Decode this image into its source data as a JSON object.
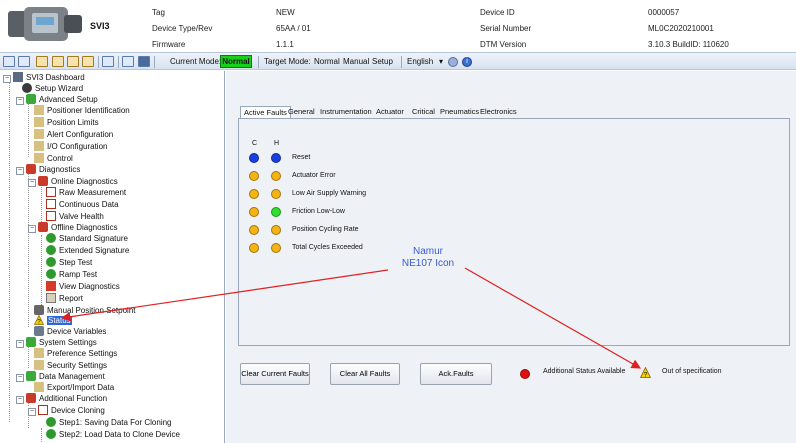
{
  "header": {
    "model": "SVI3",
    "tag_label": "Tag",
    "tag_value": "NEW",
    "device_type_label": "Device Type/Rev",
    "device_type_value": "65AA / 01",
    "firmware_label": "Firmware",
    "firmware_value": "1.1.1",
    "device_id_label": "Device ID",
    "device_id_value": "0000057",
    "serial_label": "Serial Number",
    "serial_value": "ML0C2020210001",
    "dtm_label": "DTM Version",
    "dtm_value": "3.10.3 BuildID: 110620"
  },
  "toolbar": {
    "current_mode_label": "Current Mode:",
    "current_mode_value": "Normal",
    "target_mode_label": "Target Mode:",
    "mode_normal": "Normal",
    "mode_manual": "Manual",
    "mode_setup": "Setup",
    "language": "English"
  },
  "tree": {
    "root": "SVI3 Dashboard",
    "setup_wizard": "Setup Wizard",
    "advanced_setup": "Advanced Setup",
    "positioner_identification": "Positioner Identification",
    "position_limits": "Position Limits",
    "alert_configuration": "Alert Configuration",
    "io_configuration": "I/O Configuration",
    "control": "Control",
    "diagnostics": "Diagnostics",
    "online_diagnostics": "Online Diagnostics",
    "raw_measurement": "Raw Measurement",
    "continuous_data": "Continuous Data",
    "valve_health": "Valve Health",
    "offline_diagnostics": "Offline Diagnostics",
    "standard_signature": "Standard Signature",
    "extended_signature": "Extended Signature",
    "step_test": "Step Test",
    "ramp_test": "Ramp Test",
    "view_diagnostics": "View Diagnostics",
    "report": "Report",
    "manual_position_setpoint": "Manual Position Setpoint",
    "status": "Status",
    "device_variables": "Device Variables",
    "system_settings": "System Settings",
    "preference_settings": "Preference Settings",
    "security_settings": "Security Settings",
    "data_management": "Data Management",
    "export_import_data": "Export/Import Data",
    "additional_function": "Additional Function",
    "device_cloning": "Device Cloning",
    "step1": "Step1: Saving Data For Cloning",
    "step2": "Step2: Load Data to Clone Device"
  },
  "tabs": [
    "Active Faults",
    "General",
    "Instrumentation",
    "Actuator",
    "Critical",
    "Pneumatics",
    "Electronics"
  ],
  "fault_table": {
    "col_c": "C",
    "col_h": "H",
    "rows": [
      {
        "label": "Reset",
        "c_color": "#1a3fe0",
        "h_color": "#1a3fe0"
      },
      {
        "label": "Actuator Error",
        "c_color": "#f5b414",
        "h_color": "#f5b414"
      },
      {
        "label": "Low Air Supply Warning",
        "c_color": "#f5b414",
        "h_color": "#f5b414"
      },
      {
        "label": "Friction Low-Low",
        "c_color": "#f5b414",
        "h_color": "#2ee02e"
      },
      {
        "label": "Position Cycling Rate",
        "c_color": "#f5b414",
        "h_color": "#f5b414"
      },
      {
        "label": "Total Cycles Exceeded",
        "c_color": "#f5b414",
        "h_color": "#f5b414"
      }
    ]
  },
  "buttons": {
    "clear_current": "Clear Current Faults",
    "clear_all": "Clear All Faults",
    "ack": "Ack.Faults"
  },
  "status_bar": {
    "additional_status": "Additional Status Available",
    "additional_status_color": "#e01010",
    "out_of_spec": "Out of specification"
  },
  "annotation": {
    "line1": "Namur",
    "line2": "NE107 Icon"
  }
}
